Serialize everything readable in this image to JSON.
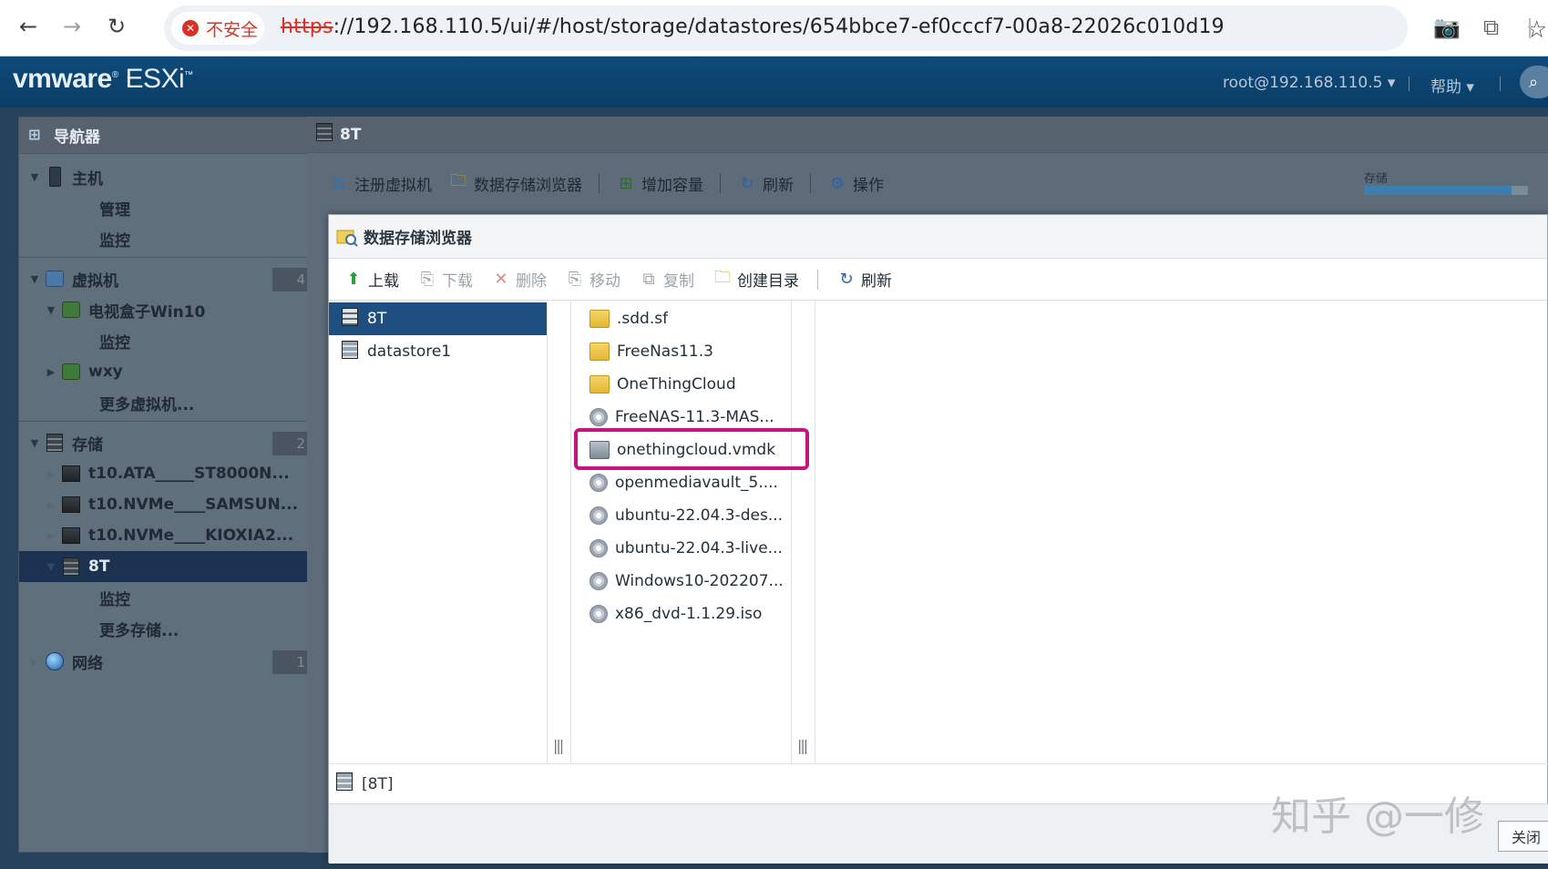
{
  "browser": {
    "insecure_label": "不安全",
    "url_scheme": "https",
    "url_rest": "://192.168.110.5/ui/#/host/storage/datastores/654bbce7-ef0cccf7-00a8-22026c010d19"
  },
  "header": {
    "logo_brand": "vmware",
    "logo_product": "ESXi",
    "user": "root@192.168.110.5 ▾",
    "help": "帮助 ▾"
  },
  "navigator": {
    "title": "导航器",
    "host": {
      "label": "主机",
      "children": [
        "管理",
        "监控"
      ]
    },
    "vms": {
      "label": "虚拟机",
      "count": "4",
      "vm1": "电视盒子Win10",
      "vm1_child": "监控",
      "vm2": "wxy",
      "more": "更多虚拟机..."
    },
    "storage": {
      "label": "存储",
      "count": "2",
      "items": [
        "t10.ATA_____ST8000N...",
        "t10.NVMe____SAMSUN...",
        "t10.NVMe____KIOXIA2..."
      ],
      "selected": "8T",
      "selected_child": "监控",
      "more": "更多存储..."
    },
    "network": {
      "label": "网络",
      "count": "1"
    }
  },
  "content": {
    "title": "8T",
    "toolbar": [
      "注册虚拟机",
      "数据存储浏览器",
      "增加容量",
      "刷新",
      "操作"
    ],
    "storage_label": "存储"
  },
  "dialog": {
    "title": "数据存储浏览器",
    "toolbar": {
      "upload": "上载",
      "download": "下载",
      "delete": "删除",
      "move": "移动",
      "copy": "复制",
      "mkdir": "创建目录",
      "refresh": "刷新"
    },
    "datastores": [
      "8T",
      "datastore1"
    ],
    "files": [
      {
        "name": ".sdd.sf",
        "type": "folder"
      },
      {
        "name": "FreeNas11.3",
        "type": "folder"
      },
      {
        "name": "OneThingCloud",
        "type": "folder"
      },
      {
        "name": "FreeNAS-11.3-MAS...",
        "type": "iso"
      },
      {
        "name": "onethingcloud.vmdk",
        "type": "vmdk"
      },
      {
        "name": "openmediavault_5....",
        "type": "iso"
      },
      {
        "name": "ubuntu-22.04.3-des...",
        "type": "iso"
      },
      {
        "name": "ubuntu-22.04.3-live...",
        "type": "iso"
      },
      {
        "name": "Windows10-202207...",
        "type": "iso"
      },
      {
        "name": "x86_dvd-1.1.29.iso",
        "type": "iso"
      }
    ],
    "path": "[8T]",
    "close": "关闭"
  },
  "watermark": "知乎 @一修"
}
